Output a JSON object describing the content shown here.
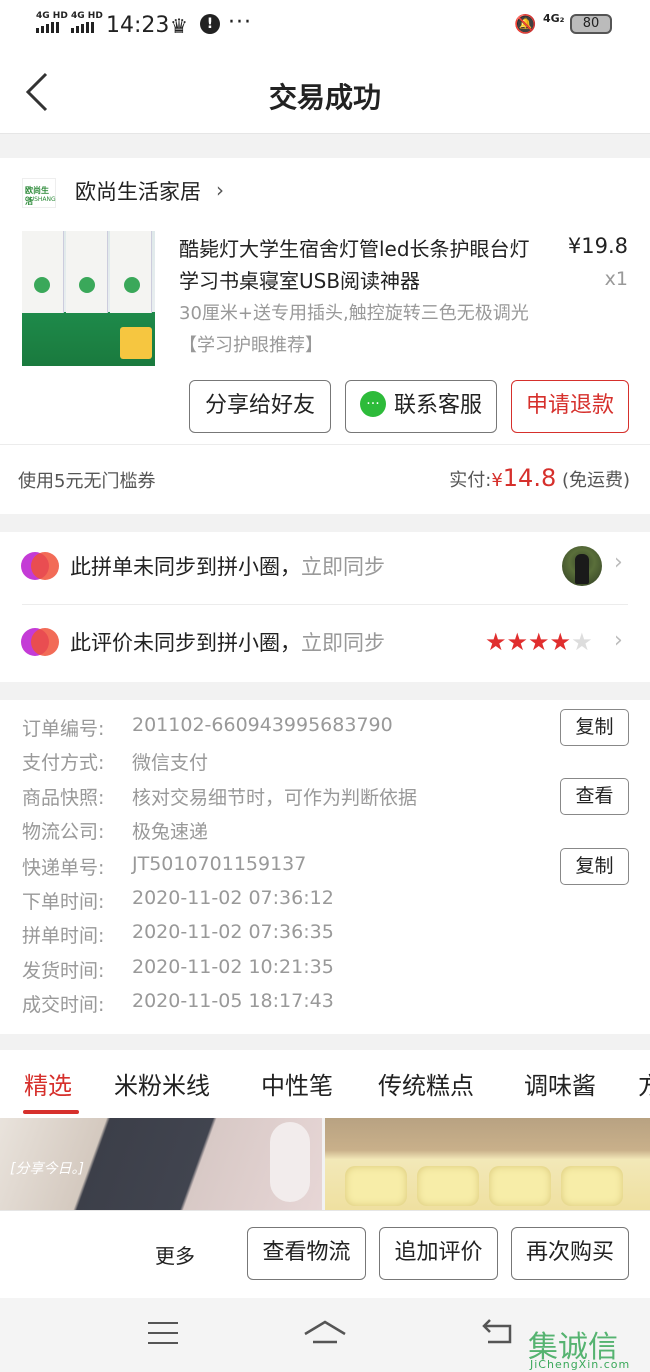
{
  "status_bar": {
    "network1": "4G HD",
    "network2": "4G HD",
    "time": "14:23",
    "network_right": "4G₂",
    "battery": "80",
    "icons": [
      "crown-icon",
      "alert-icon",
      "more-dots-icon",
      "bell-off-icon",
      "battery-icon"
    ]
  },
  "header": {
    "back_icon": "chevron-left-icon",
    "title": "交易成功"
  },
  "shop": {
    "logo_line1": "欧尚生活",
    "logo_line2": "OUSHANG",
    "name": "欧尚生活家居",
    "chevron": "›"
  },
  "product": {
    "title": "酷毙灯大学生宿舍灯管led长条护眼台灯学习书桌寝室USB阅读神器",
    "price": "¥19.8",
    "quantity": "x1",
    "spec": "30厘米+送专用插头,触控旋转三色无极调光【学习护眼推荐】"
  },
  "order_actions": {
    "share": "分享给好友",
    "service": "联系客服",
    "refund": "申请退款",
    "service_icon": "wechat-chat-icon"
  },
  "payment": {
    "coupon": "使用5元无门槛券",
    "paid_label": "实付:",
    "currency": "¥",
    "amount": "14.8",
    "shipping_note": "(免运费)"
  },
  "sync": {
    "group_text": "此拼单未同步到拼小圈，",
    "group_action": "立即同步",
    "review_text": "此评价未同步到拼小圈，",
    "review_action": "立即同步",
    "rating_filled": 4,
    "rating_total": 5,
    "chevron": "›"
  },
  "order_info": {
    "rows": [
      {
        "label": "订单编号:",
        "value": "201102-660943995683790",
        "button": "复制"
      },
      {
        "label": "支付方式:",
        "value": "微信支付"
      },
      {
        "label": "商品快照:",
        "value": "核对交易细节时，可作为判断依据",
        "button": "查看"
      },
      {
        "label": "物流公司:",
        "value": "极兔速递"
      },
      {
        "label": "快递单号:",
        "value": "JT5010701159137",
        "button": "复制"
      },
      {
        "label": "下单时间:",
        "value": "2020-11-02 07:36:12"
      },
      {
        "label": "拼单时间:",
        "value": "2020-11-02 07:36:35"
      },
      {
        "label": "发货时间:",
        "value": "2020-11-02 10:21:35"
      },
      {
        "label": "成交时间:",
        "value": "2020-11-05 18:17:43"
      }
    ]
  },
  "tabs": [
    "精选",
    "米粉米线",
    "中性笔",
    "传统糕点",
    "调味酱",
    "方"
  ],
  "recommend": {
    "item1_text": "[分享今日。]"
  },
  "bottom_actions": {
    "more": "更多",
    "logistics": "查看物流",
    "add_review": "追加评价",
    "rebuy": "再次购买"
  },
  "watermark": {
    "text": "集诚信",
    "sub": "JiChengXin.com"
  }
}
